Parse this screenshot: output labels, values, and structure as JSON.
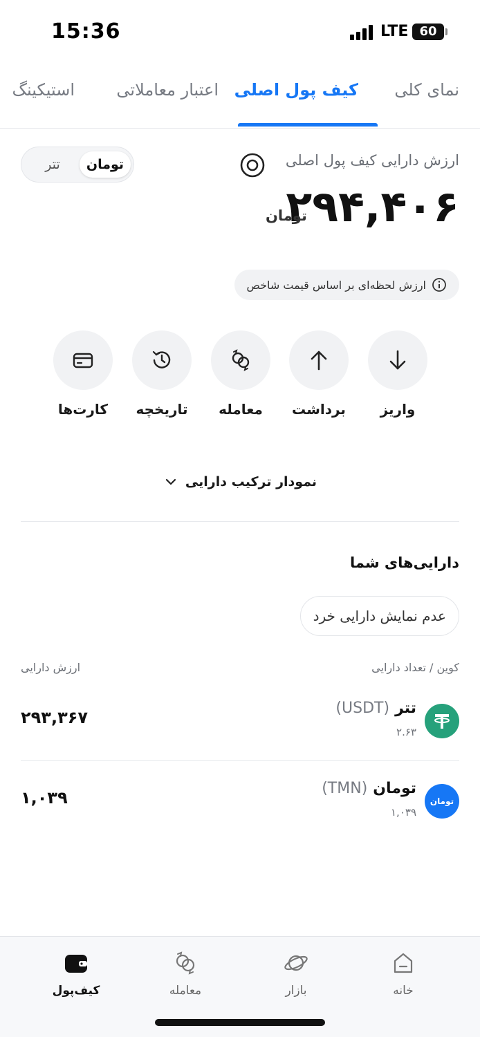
{
  "status_bar": {
    "time": "15:36",
    "network": "LTE",
    "battery": "60"
  },
  "tabs": [
    {
      "label": "نمای کلی",
      "active": false
    },
    {
      "label": "کیف پول اصلی",
      "active": true
    },
    {
      "label": "اعتبار معاملاتی",
      "active": false
    },
    {
      "label": "استیکینگ",
      "active": false
    }
  ],
  "balance": {
    "label": "ارزش دارایی کیف پول اصلی",
    "amount": "۲۹۴,۴۰۶",
    "unit": "تومان",
    "toggle": {
      "selected": "تومان",
      "other": "تتر"
    },
    "price_note": "ارزش لحظه‌ای بر اساس قیمت شاخص"
  },
  "actions": [
    {
      "label": "واریز",
      "icon": "arrow-down-icon"
    },
    {
      "label": "برداشت",
      "icon": "arrow-up-icon"
    },
    {
      "label": "معامله",
      "icon": "exchange-icon"
    },
    {
      "label": "تاریخچه",
      "icon": "history-icon"
    },
    {
      "label": "کارت‌ها",
      "icon": "card-icon"
    }
  ],
  "chart_toggle": {
    "label": "نمودار ترکیب دارایی"
  },
  "assets": {
    "title": "دارایی‌های شما",
    "hide_small": "عدم نمایش دارایی خرد",
    "col_coin": "کوین / تعداد دارایی",
    "col_value": "ارزش دارایی",
    "rows": [
      {
        "name": "تتر",
        "symbol": "(USDT)",
        "amount": "۲.۶۳",
        "value": "۲۹۳,۳۶۷",
        "color": "#26a17b"
      },
      {
        "name": "تومان",
        "symbol": "(TMN)",
        "amount": "۱,۰۳۹",
        "value": "۱,۰۳۹",
        "color": "#1677f5",
        "icon_text": "تومان"
      }
    ]
  },
  "bottom_nav": [
    {
      "label": "خانه",
      "icon": "home-icon",
      "active": false
    },
    {
      "label": "بازار",
      "icon": "planet-icon",
      "active": false
    },
    {
      "label": "معامله",
      "icon": "exchange-icon",
      "active": false
    },
    {
      "label": "کیف‌پول",
      "icon": "wallet-icon",
      "active": true
    }
  ],
  "colors": {
    "accent": "#1677f5",
    "tether": "#26a17b"
  }
}
